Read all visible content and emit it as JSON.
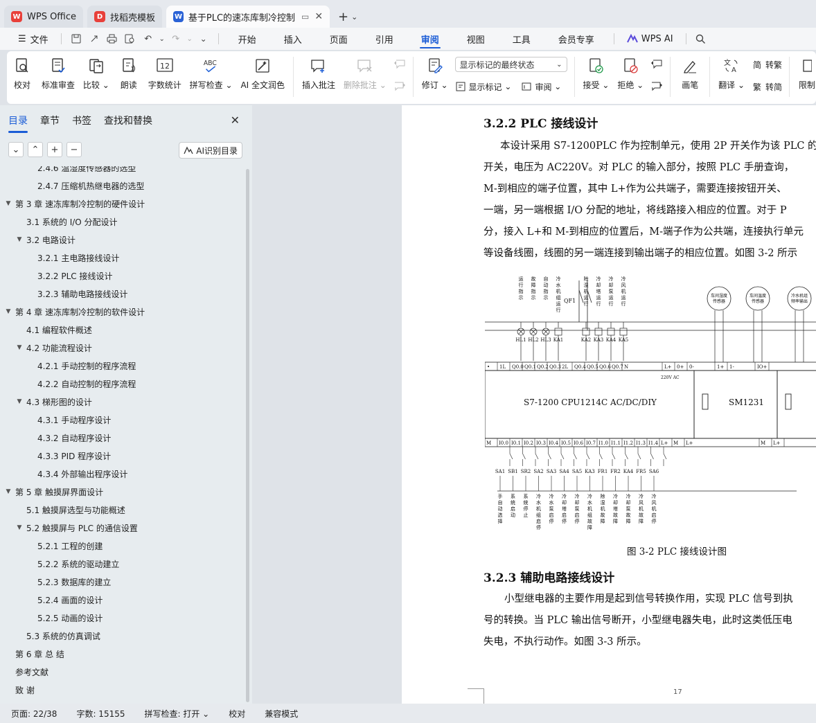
{
  "tabs": [
    {
      "label": "WPS Office",
      "icon": "wps-logo-icon",
      "color": "#e8403a"
    },
    {
      "label": "找稻壳模板",
      "icon": "docer-icon",
      "color": "#e8403a"
    },
    {
      "label": "基于PLC的速冻库制冷控制系",
      "icon": "word-doc-icon",
      "color": "#2a62d6",
      "active": true
    }
  ],
  "menu": {
    "file": "文件",
    "ribbon_tabs": [
      "开始",
      "插入",
      "页面",
      "引用",
      "审阅",
      "视图",
      "工具",
      "会员专享"
    ],
    "active_tab": "审阅",
    "wps_ai": "WPS AI"
  },
  "ribbon": {
    "proofread": "校对",
    "std_review": "标准审查",
    "compare": "比较",
    "read_aloud": "朗读",
    "word_count": "字数统计",
    "spell_check": "拼写检查",
    "ai_polish": "AI 全文润色",
    "insert_comment": "插入批注",
    "delete_comment": "删除批注",
    "track": "修订",
    "markup_dropdown": "显示标记的最终状态",
    "show_markup": "显示标记",
    "review": "审阅",
    "accept": "接受",
    "reject": "拒绝",
    "pen": "画笔",
    "translate": "翻译",
    "to_trad": "繁转简",
    "trad": "转繁",
    "trad_s": "转简",
    "limit": "限制"
  },
  "nav": {
    "tabs": [
      "目录",
      "章节",
      "书签",
      "查找和替换"
    ],
    "active": "目录",
    "ai_toc": "AI识别目录",
    "items": [
      {
        "text": "2.4.6  温湿度传感器的选型",
        "level": 3
      },
      {
        "text": "2.4.7  压缩机热继电器的选型",
        "level": 3
      },
      {
        "text": "第 3 章  速冻库制冷控制的硬件设计",
        "level": 1,
        "arrow": true
      },
      {
        "text": "3.1  系统的 I/O 分配设计",
        "level": 2
      },
      {
        "text": "3.2  电路设计",
        "level": 2,
        "arrow": true
      },
      {
        "text": "3.2.1  主电路接线设计",
        "level": 3
      },
      {
        "text": "3.2.2 PLC 接线设计",
        "level": 3
      },
      {
        "text": "3.2.3  辅助电路接线设计",
        "level": 3
      },
      {
        "text": "第 4 章  速冻库制冷控制的软件设计",
        "level": 1,
        "arrow": true
      },
      {
        "text": "4.1  编程软件概述",
        "level": 2
      },
      {
        "text": "4.2  功能流程设计",
        "level": 2,
        "arrow": true
      },
      {
        "text": "4.2.1 手动控制的程序流程",
        "level": 3
      },
      {
        "text": "4.2.2 自动控制的程序流程",
        "level": 3
      },
      {
        "text": "4.3  梯形图的设计",
        "level": 2,
        "arrow": true
      },
      {
        "text": "4.3.1 手动程序设计",
        "level": 3
      },
      {
        "text": "4.3.2 自动程序设计",
        "level": 3
      },
      {
        "text": "4.3.3 PID 程序设计",
        "level": 3
      },
      {
        "text": "4.3.4  外部输出程序设计",
        "level": 3
      },
      {
        "text": "第 5 章  触摸屏界面设计",
        "level": 1,
        "arrow": true
      },
      {
        "text": "5.1 触摸屏选型与功能概述",
        "level": 2
      },
      {
        "text": "5.2 触摸屏与 PLC 的通信设置",
        "level": 2,
        "arrow": true
      },
      {
        "text": "5.2.1  工程的创建",
        "level": 3
      },
      {
        "text": "5.2.2  系统的驱动建立",
        "level": 3
      },
      {
        "text": "5.2.3  数据库的建立",
        "level": 3
      },
      {
        "text": "5.2.4  画面的设计",
        "level": 3
      },
      {
        "text": "5.2.5  动画的设计",
        "level": 3
      },
      {
        "text": "5.3 系统的仿真调试",
        "level": 2
      },
      {
        "text": "第 6 章  总    结",
        "level": 1
      },
      {
        "text": "参考文献",
        "level": 1
      },
      {
        "text": "致    谢",
        "level": 1
      }
    ]
  },
  "doc": {
    "heading1": "3.2.2 PLC 接线设计",
    "para1": [
      "本设计采用 S7-1200PLC 作为控制单元，使用 2P 开关作为该 PLC 的",
      "开关，电压为 AC220V。对 PLC 的输入部分，按照 PLC 手册查询，",
      "M-到相应的端子位置，其中 L+作为公共端子，需要连接按钮开关、",
      "一端，另一端根据 I/O 分配的地址，将线路接入相应的位置。对于 P",
      "分，接入 L+和 M-到相应的位置后，M-端子作为公共端，连接执行单元",
      "等设备线圈，线圈的另一端连接到输出端子的相应位置。如图 3-2 所示"
    ],
    "diagram": {
      "cpu_label": "S7-1200  CPU1214C  AC/DC/DIY",
      "sm_label": "SM1231",
      "voltage": "220V AC",
      "switch": "QF1",
      "top_lamp_labels": [
        "运行指示",
        "故障指示",
        "自动指示",
        "冷水机组运行"
      ],
      "top_relay_labels": [
        "除湿机运行",
        "冷却塔运行",
        "冷却泵运行",
        "冷风机运行"
      ],
      "lamp_tags": [
        "HL1",
        "HL2",
        "HL3",
        "KA1"
      ],
      "relay_tags": [
        "KA2",
        "KA3",
        "KA4",
        "KA5"
      ],
      "sensors": [
        "车间湿度传感器",
        "车间温度传感器",
        "冷水机组频率输出"
      ],
      "top_terminals": [
        "•",
        "1L",
        "Q0.0",
        "Q0.1",
        "Q0.2",
        "Q0.3",
        "2L",
        "Q0.4",
        "Q0.5",
        "Q0.6",
        "Q0.7",
        "N",
        "L+",
        "0+",
        "0-",
        "1+",
        "1-",
        "IO+"
      ],
      "bottom_terminals": [
        "M",
        "I0.0",
        "I0.1",
        "I0.2",
        "I0.3",
        "I0.4",
        "I0.5",
        "I0.6",
        "I0.7",
        "I1.0",
        "I1.1",
        "I1.2",
        "I1.3",
        "I1.4",
        "L+",
        "M",
        "L+",
        "M",
        "L+"
      ],
      "input_tags": [
        "SA1",
        "SB1",
        "SR2",
        "SA2",
        "SA3",
        "SA4",
        "SA5",
        "KA3",
        "FR1",
        "FR2",
        "KA4",
        "FR5",
        "SA6"
      ],
      "input_labels": [
        "手自动选择",
        "系统启动",
        "系统停止",
        "冷水机组启停",
        "冷水泵启停",
        "冷却塔启停",
        "冷却泵启停",
        "冷水机组故障",
        "除湿机故障",
        "冷却塔故障",
        "冷却泵故障",
        "冷风机故障",
        "冷风机启停"
      ]
    },
    "caption": "图 3-2 PLC 接线设计图",
    "heading2": "3.2.3  辅助电路接线设计",
    "para2": [
      "小型继电器的主要作用是起到信号转换作用，实现 PLC 信号到执",
      "号的转换。当 PLC 输出信号断开，小型继电器失电，此时这类低压电",
      "失电，不执行动作。如图 3-3 所示。"
    ],
    "page_number": "17"
  },
  "status": {
    "page": "页面: 22/38",
    "words": "字数: 15155",
    "spell": "拼写检查: 打开",
    "proof": "校对",
    "compat": "兼容模式"
  },
  "colors": {
    "accent": "#1a5cd6",
    "wps_red": "#e8403a",
    "word_blue": "#2a62d6"
  }
}
